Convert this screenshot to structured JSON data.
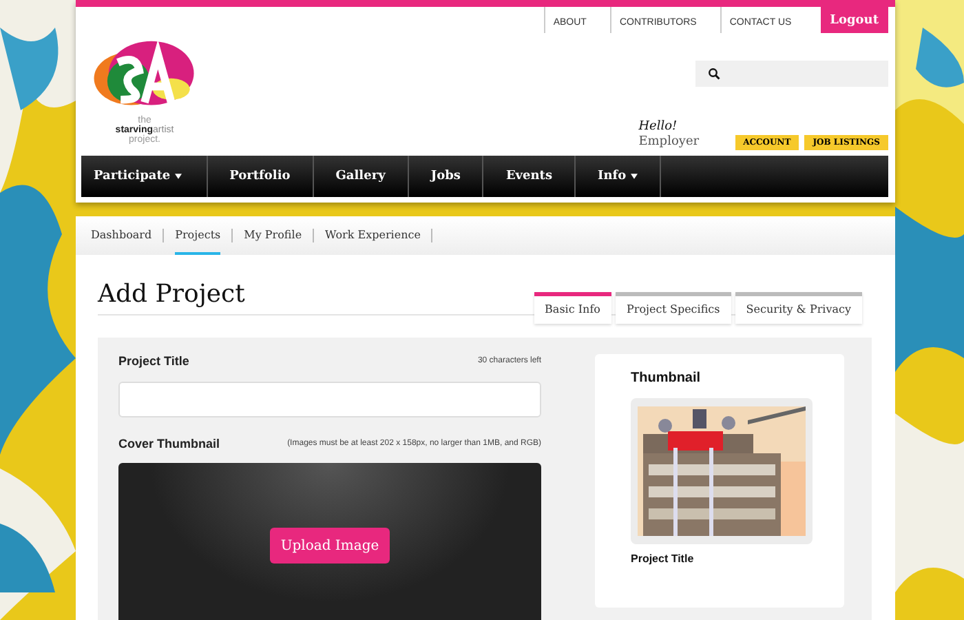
{
  "top_links": [
    "ABOUT",
    "CONTRIBUTORS",
    "CONTACT US"
  ],
  "logout": "Logout",
  "logo": {
    "line1": "the",
    "line2_bold": "starving",
    "line2_rest": "artist",
    "line3": "project."
  },
  "greeting": {
    "hello": "Hello!",
    "role": "Employer"
  },
  "user_buttons": [
    "ACCOUNT",
    "JOB LISTINGS"
  ],
  "nav": [
    {
      "label": "Participate",
      "dropdown": true
    },
    {
      "label": "Portfolio",
      "dropdown": false
    },
    {
      "label": "Gallery",
      "dropdown": false
    },
    {
      "label": "Jobs",
      "dropdown": false
    },
    {
      "label": "Events",
      "dropdown": false
    },
    {
      "label": "Info",
      "dropdown": true
    }
  ],
  "subnav": [
    {
      "label": "Dashboard",
      "selected": false
    },
    {
      "label": "Projects",
      "selected": true
    },
    {
      "label": "My Profile",
      "selected": false
    },
    {
      "label": "Work Experience",
      "selected": false
    }
  ],
  "page_title": "Add Project",
  "tabs": [
    {
      "label": "Basic Info",
      "selected": true
    },
    {
      "label": "Project Specifics",
      "selected": false
    },
    {
      "label": "Security & Privacy",
      "selected": false
    }
  ],
  "form": {
    "title_label": "Project Title",
    "title_counter": "30 characters left",
    "cover_label": "Cover Thumbnail",
    "cover_hint": "(Images must be at least 202 x 158px, no larger than 1MB, and RGB)",
    "upload_button": "Upload Image"
  },
  "preview": {
    "heading": "Thumbnail",
    "caption": "Project Title"
  }
}
